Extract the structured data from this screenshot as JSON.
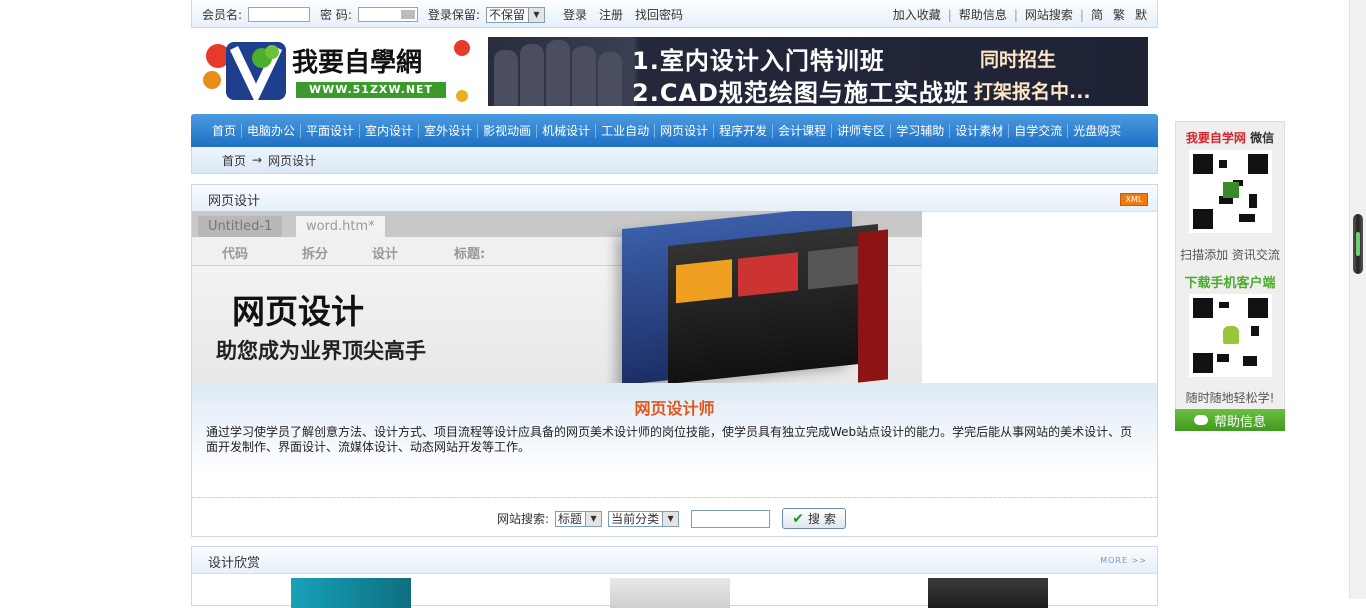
{
  "topbar": {
    "member_label": "会员名:",
    "password_label": "密  码:",
    "remember_label": "登录保留:",
    "remember_value": "不保留",
    "login": "登录",
    "register": "注册",
    "recover": "找回密码",
    "favorites": "加入收藏",
    "help": "帮助信息",
    "site_search": "网站搜索",
    "lang_simple": "简",
    "lang_trad": "繁",
    "lang_default": "默"
  },
  "logo": {
    "text": "我要自學網",
    "url_text": "WWW.51ZXW.NET"
  },
  "banner": {
    "line1": "1.室内设计入门特训班",
    "line2": "2.CAD规范绘图与施工实战班",
    "tag1": "同时招生",
    "tag2": "打架报名中..."
  },
  "nav": [
    "首页",
    "电脑办公",
    "平面设计",
    "室内设计",
    "室外设计",
    "影视动画",
    "机械设计",
    "工业自动",
    "网页设计",
    "程序开发",
    "会计课程",
    "讲师专区",
    "学习辅助",
    "设计素材",
    "自学交流",
    "光盘购买"
  ],
  "breadcrumb": {
    "home": "首页",
    "arrow": "→",
    "current": "网页设计"
  },
  "main": {
    "title": "网页设计",
    "xml_badge": "XML",
    "hero": {
      "tab1": "Untitled-1",
      "tab2": "word.htm*",
      "tool_code": "代码",
      "tool_split": "拆分",
      "tool_design": "设计",
      "tool_title": "标题:",
      "big_text": "网页设计",
      "sub_text": "助您成为业界顶尖高手"
    },
    "desc_title": "网页设计师",
    "desc_text": "通过学习使学员了解创意方法、设计方式、项目流程等设计应具备的网页美术设计师的岗位技能，使学员具有独立完成Web站点设计的能力。学完后能从事网站的美术设计、页面开发制作、界面设计、流媒体设计、动态网站开发等工作。",
    "search": {
      "label": "网站搜索:",
      "field_select": "标题",
      "scope_select": "当前分类",
      "button": "搜 索"
    }
  },
  "design": {
    "title": "设计欣赏",
    "more": "MORE >>"
  },
  "side": {
    "title_red": "我要自学网",
    "title_black": " 微信",
    "caption1": "扫描添加  资讯交流",
    "mobile_title": "下载手机客户端",
    "caption2": "随时随地轻松学!",
    "help": "帮助信息"
  }
}
